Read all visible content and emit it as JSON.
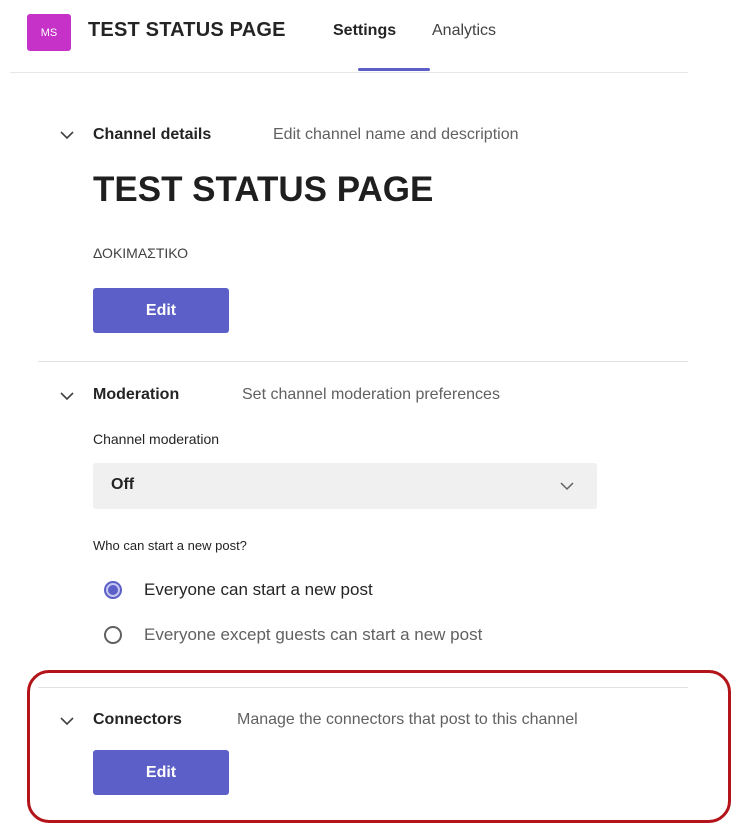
{
  "header": {
    "avatar_initials": "MS",
    "team_name": "TEST  STATUS PAGE",
    "tabs": [
      {
        "label": "Settings",
        "active": true
      },
      {
        "label": "Analytics",
        "active": false
      }
    ],
    "accent_color": "#5b5fc7",
    "avatar_color": "#c632c8"
  },
  "channel_details": {
    "title": "Channel details",
    "description": "Edit channel name and description",
    "channel_name": "TEST STATUS PAGE",
    "channel_description": "ΔΟΚΙΜΑΣΤΙΚΟ",
    "edit_label": "Edit"
  },
  "moderation": {
    "title": "Moderation",
    "description": "Set channel moderation preferences",
    "channel_moderation_label": "Channel moderation",
    "channel_moderation_value": "Off",
    "post_question": "Who can start a new post?",
    "options": [
      {
        "label": "Everyone can start a new post",
        "checked": true
      },
      {
        "label": "Everyone except guests can start a new post",
        "checked": false
      }
    ]
  },
  "connectors": {
    "title": "Connectors",
    "description": "Manage the connectors that post to this channel",
    "edit_label": "Edit",
    "highlight_color": "#b3141a"
  },
  "icons": [
    "chevron-down-icon",
    "radio-selected-icon",
    "radio-unselected-icon"
  ]
}
